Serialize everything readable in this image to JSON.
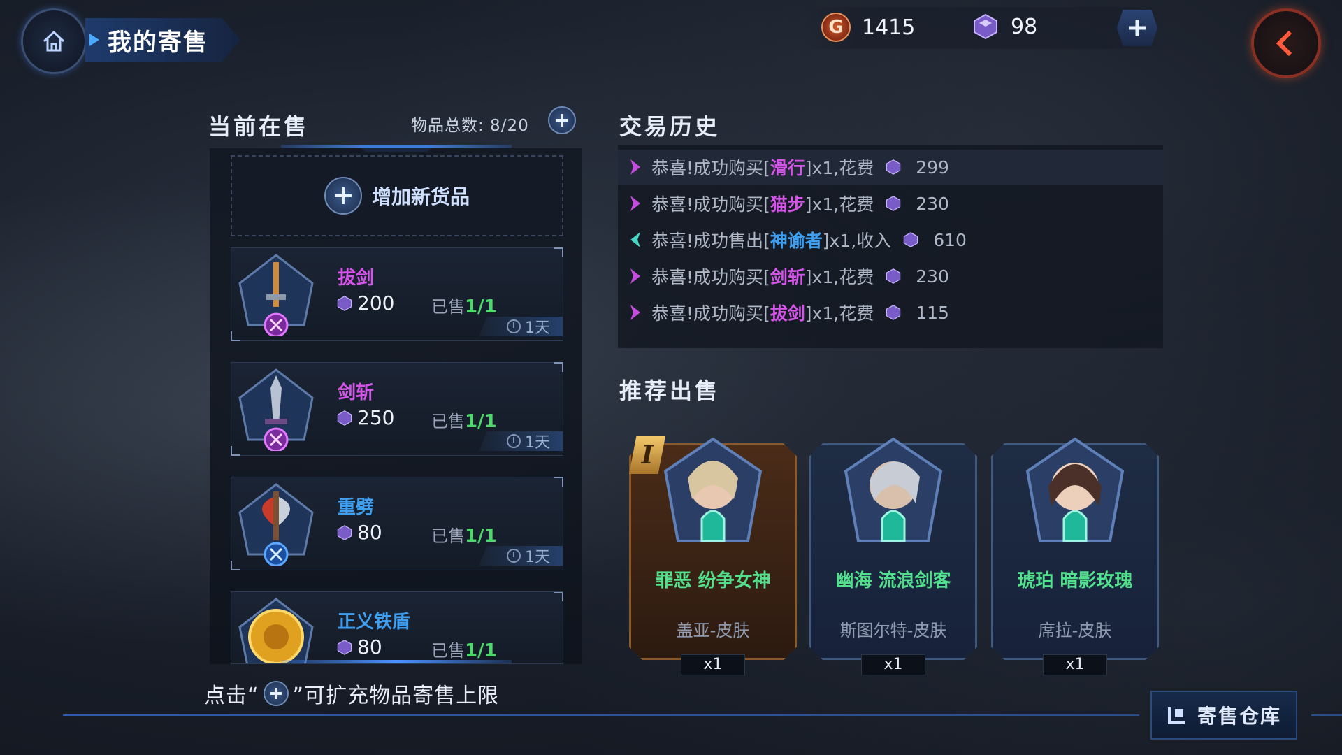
{
  "header": {
    "title": "我的寄售",
    "gold_amount": "1415",
    "gem_amount": "98",
    "gold_symbol": "G"
  },
  "on_sale": {
    "title": "当前在售",
    "count_text": "物品总数: 8/20",
    "add_label": "增加新货品",
    "items": [
      {
        "name": "拔剑",
        "price": "200",
        "sold_label": "已售",
        "sold_value": "1/1",
        "time": "1天",
        "name_color": "#d454e8",
        "icon": "sword-icon"
      },
      {
        "name": "剑斩",
        "price": "250",
        "sold_label": "已售",
        "sold_value": "1/1",
        "time": "1天",
        "name_color": "#d454e8",
        "icon": "blade-icon"
      },
      {
        "name": "重劈",
        "price": "80",
        "sold_label": "已售",
        "sold_value": "1/1",
        "time": "1天",
        "name_color": "#3e9ef0",
        "icon": "axe-icon"
      },
      {
        "name": "正义铁盾",
        "price": "80",
        "sold_label": "已售",
        "sold_value": "1/1",
        "time": "",
        "name_color": "#3e9ef0",
        "icon": "shield-icon"
      }
    ]
  },
  "history": {
    "title": "交易历史",
    "rows": [
      {
        "prefix": "恭喜!成功购买[",
        "item": "滑行",
        "suffix": "]x1,花费",
        "amount": "299",
        "type": "buy",
        "item_color": "#d454e8"
      },
      {
        "prefix": "恭喜!成功购买[",
        "item": "猫步",
        "suffix": "]x1,花费",
        "amount": "230",
        "type": "buy",
        "item_color": "#d454e8"
      },
      {
        "prefix": "恭喜!成功售出[",
        "item": "神谕者",
        "suffix": "]x1,收入",
        "amount": "610",
        "type": "sell",
        "item_color": "#3e9ef0"
      },
      {
        "prefix": "恭喜!成功购买[",
        "item": "剑斩",
        "suffix": "]x1,花费",
        "amount": "230",
        "type": "buy",
        "item_color": "#d454e8"
      },
      {
        "prefix": "恭喜!成功购买[",
        "item": "拔剑",
        "suffix": "]x1,花费",
        "amount": "115",
        "type": "buy",
        "item_color": "#d454e8"
      }
    ]
  },
  "recommended": {
    "title": "推荐出售",
    "cards": [
      {
        "name": "罪恶 纷争女神",
        "skin": "盖亚-皮肤",
        "qty": "x1",
        "badge": "I",
        "frame": "gold"
      },
      {
        "name": "幽海 流浪剑客",
        "skin": "斯图尔特-皮肤",
        "qty": "x1",
        "badge": "",
        "frame": "blue"
      },
      {
        "name": "琥珀 暗影玫瑰",
        "skin": "席拉-皮肤",
        "qty": "x1",
        "badge": "",
        "frame": "blue"
      }
    ]
  },
  "footer": {
    "hint_before": "点击“",
    "hint_after": "”可扩充物品寄售上限",
    "warehouse_label": "寄售仓库"
  },
  "colors": {
    "buy_arrow": "#c64ce0",
    "sell_arrow": "#47d6c4",
    "sold_value": "#4cd86b",
    "rec_name": "#52e08c"
  }
}
